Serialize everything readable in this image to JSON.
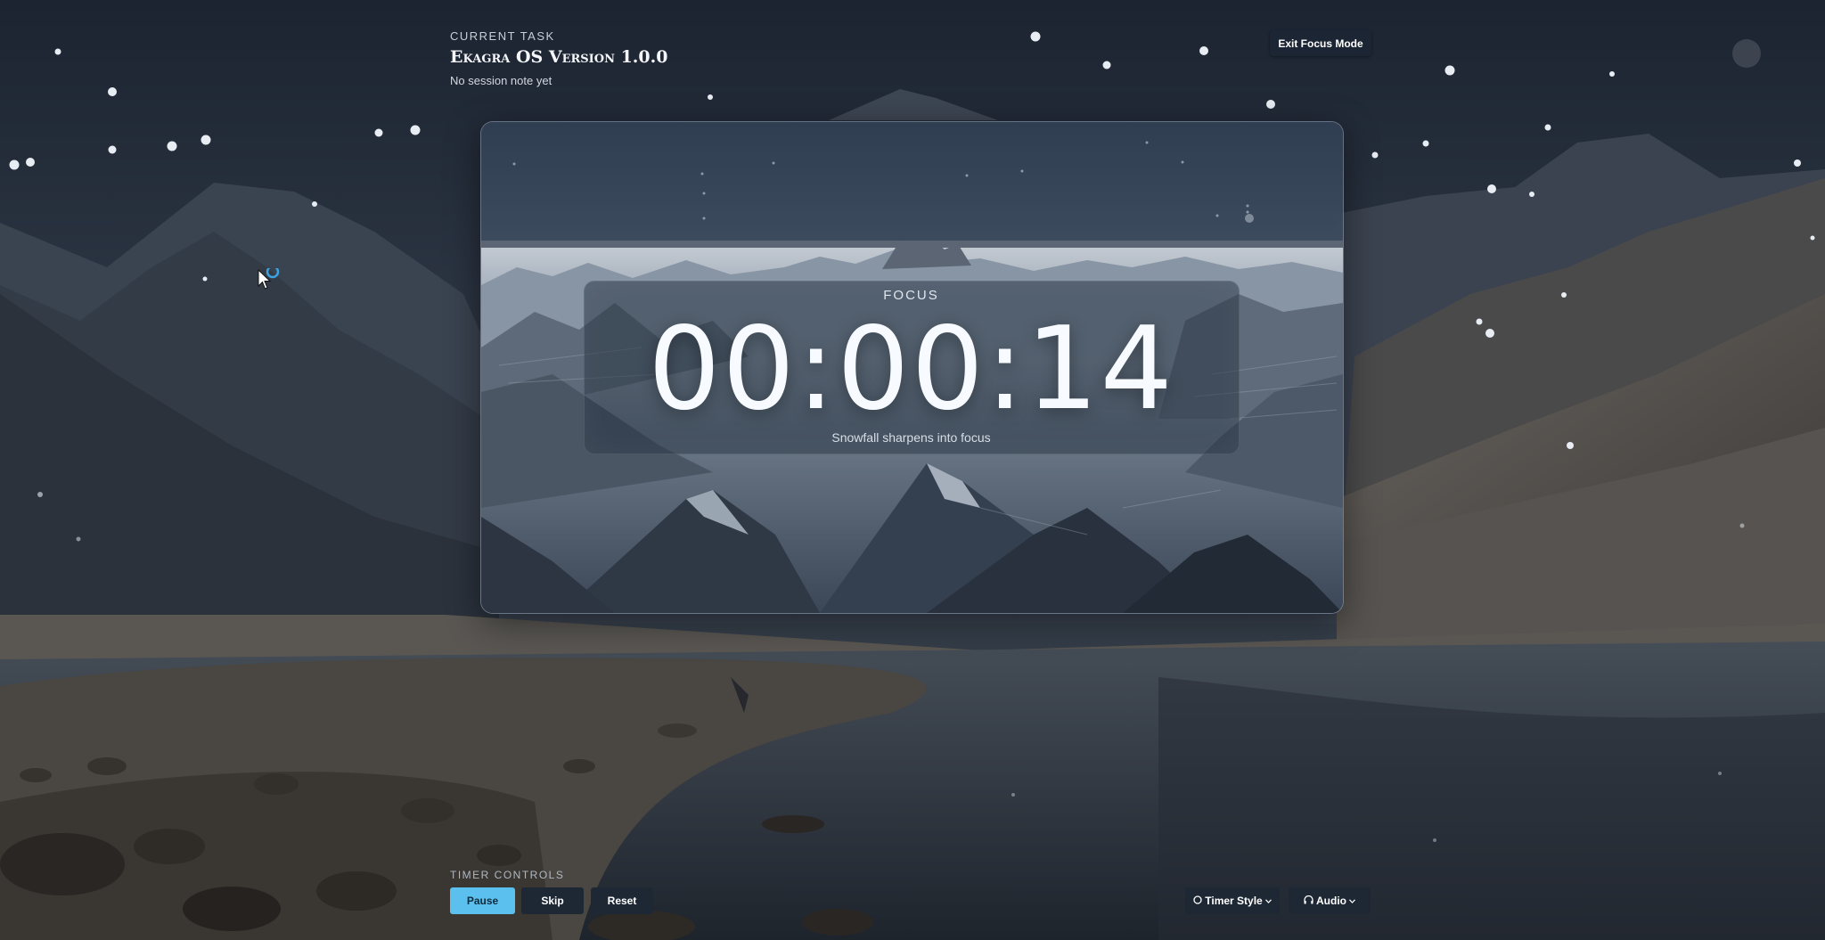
{
  "current_task": {
    "label": "CURRENT TASK",
    "title": "Ekagra OS Version 1.0.0",
    "note": "No session note yet"
  },
  "header": {
    "exit_label": "Exit Focus Mode"
  },
  "timer": {
    "mode": "FOCUS",
    "time": "00:00:14",
    "subtitle": "Snowfall sharpens into focus"
  },
  "controls": {
    "label": "TIMER CONTROLS",
    "pause": "Pause",
    "skip": "Skip",
    "reset": "Reset"
  },
  "menus": {
    "timer_style": {
      "label": "Timer Style",
      "icon": "palette-icon"
    },
    "audio": {
      "label": "Audio",
      "icon": "headphones-icon"
    }
  },
  "colors": {
    "accent": "#5cc0ef",
    "button_dark": "#1e2835",
    "top_strip": "#2f5fa0"
  }
}
